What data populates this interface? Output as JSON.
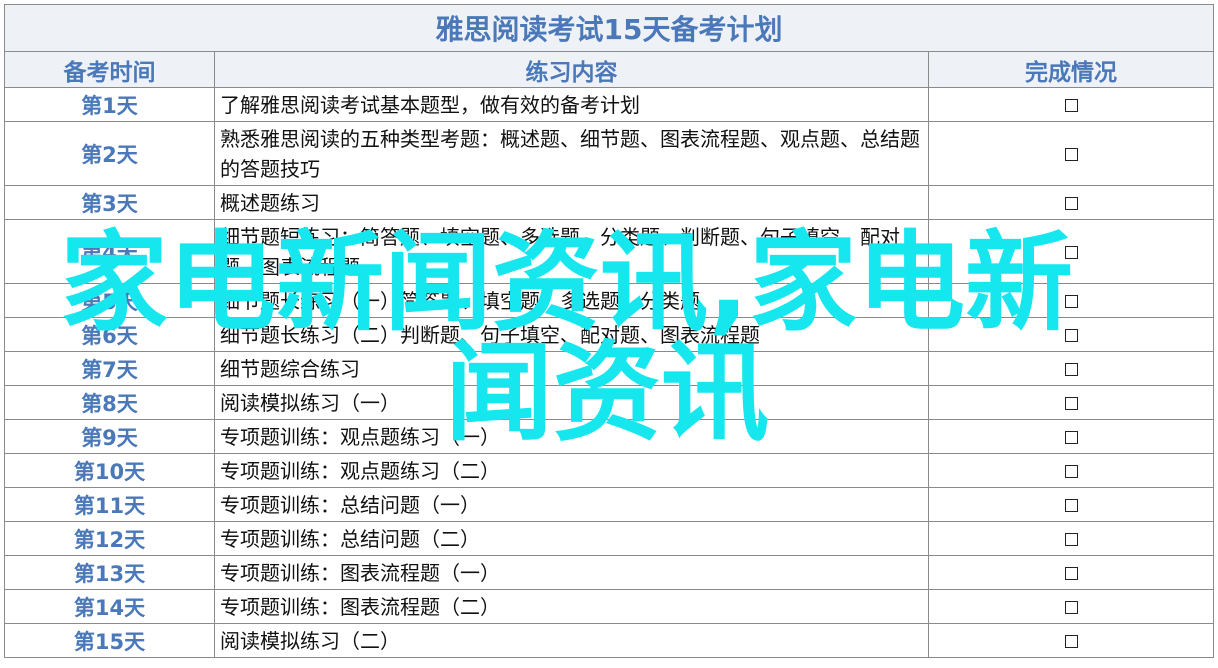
{
  "table": {
    "title": "雅思阅读考试15天备考计划",
    "headers": [
      "备考时间",
      "练习内容",
      "完成情况"
    ],
    "checkbox_glyph": "☐",
    "rows": [
      {
        "day": "第1天",
        "content": "了解雅思阅读考试基本题型，做有效的备考计划"
      },
      {
        "day": "第2天",
        "content": "熟悉雅思阅读的五种类型考题：概述题、细节题、图表流程题、观点题、总结题的答题技巧"
      },
      {
        "day": "第3天",
        "content": "概述题练习"
      },
      {
        "day": "第4天",
        "content": "细节题短练习：简答题、填空题、多选题、分类题、判断题、句子填空、配对题、图表流程题"
      },
      {
        "day": "第5天",
        "content": "细节题长练习（一）简答题、填空题、多选题、分类题"
      },
      {
        "day": "第6天",
        "content": "细节题长练习（二）判断题、句子填空、配对题、图表流程题"
      },
      {
        "day": "第7天",
        "content": "细节题综合练习"
      },
      {
        "day": "第8天",
        "content": "阅读模拟练习（一）"
      },
      {
        "day": "第9天",
        "content": "专项题训练：观点题练习（一）"
      },
      {
        "day": "第10天",
        "content": "专项题训练：观点题练习（二）"
      },
      {
        "day": "第11天",
        "content": "专项题训练：总结问题（一）"
      },
      {
        "day": "第12天",
        "content": "专项题训练：总结问题（二）"
      },
      {
        "day": "第13天",
        "content": "专项题训练：图表流程题（一）"
      },
      {
        "day": "第14天",
        "content": "专项题训练：图表流程题（二）"
      },
      {
        "day": "第15天",
        "content": "阅读模拟练习（二）"
      }
    ]
  },
  "watermark": {
    "line1": "家电新闻资讯,家电新",
    "line2": "闻资讯"
  }
}
